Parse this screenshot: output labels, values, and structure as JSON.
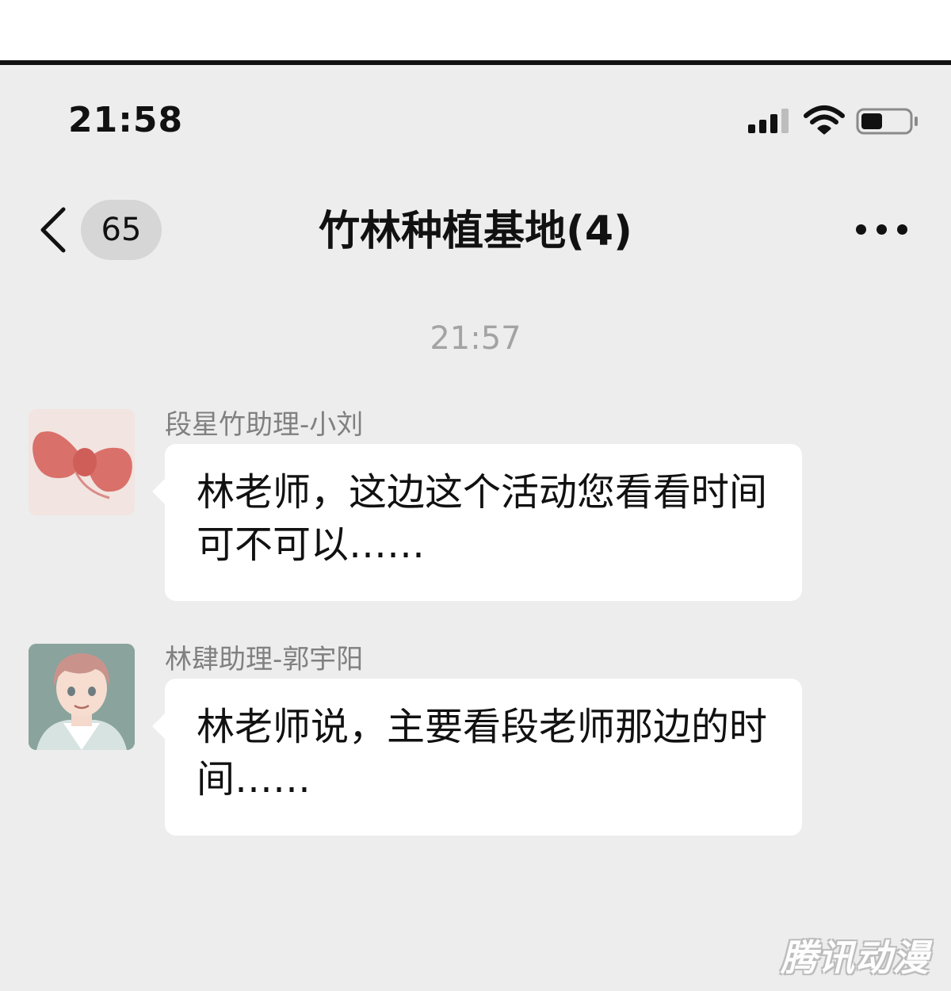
{
  "status_bar": {
    "time": "21:58",
    "signal_icon": "cellular-signal-icon",
    "wifi_icon": "wifi-icon",
    "battery_icon": "battery-icon",
    "battery_level": 0.45
  },
  "header": {
    "back_icon": "chevron-left-icon",
    "unread_count": "65",
    "title": "竹林种植基地(4)",
    "more_icon": "ellipsis-icon"
  },
  "messages": [
    {
      "timestamp": "21:57"
    }
  ],
  "chat": {
    "timestamp": "21:57",
    "items": [
      {
        "sender": "段星竹助理-小刘",
        "avatar": "bow-avatar",
        "text": "林老师，这边这个活动您看看时间可不可以……"
      },
      {
        "sender": "林肆助理-郭宇阳",
        "avatar": "person-avatar",
        "text": "林老师说，主要看段老师那边的时间……"
      }
    ]
  },
  "watermark": "腾讯动漫",
  "colors": {
    "screen_background": "#ededed",
    "bubble": "#ffffff",
    "muted_text": "#a3a3a3"
  }
}
